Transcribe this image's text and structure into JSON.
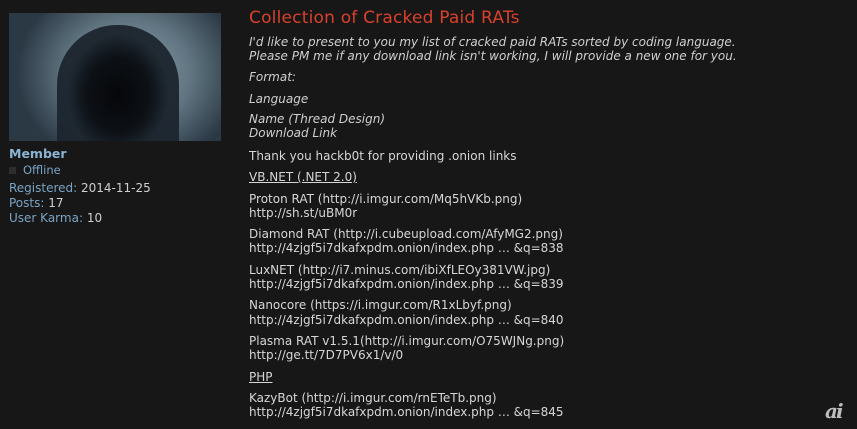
{
  "user": {
    "rank": "Member",
    "status": "Offline",
    "registered_label": "Registered:",
    "registered_value": "2014-11-25",
    "posts_label": "Posts:",
    "posts_value": "17",
    "karma_label": "User Karma:",
    "karma_value": "10"
  },
  "post": {
    "title": "Collection of Cracked Paid RATs",
    "intro_1": "I'd like to present to you my list of cracked paid RATs sorted by coding language.",
    "intro_2": "Please PM me if any download link isn't working, I will provide a new one for you.",
    "format": "Format:",
    "language": "Language",
    "name_design": "Name (Thread Design)",
    "download_link": "Download Link",
    "thanks": "Thank you hackb0t for providing .onion links",
    "section_vb": "VB.NET (.NET 2.0)",
    "proton_1": "Proton RAT (http://i.imgur.com/Mq5hVKb.png)",
    "proton_2": "http://sh.st/uBM0r",
    "diamond_1": "Diamond RAT (http://i.cubeupload.com/AfyMG2.png)",
    "diamond_2": "http://4zjgf5i7dkafxpdm.onion/index.php … &q=838",
    "luxnet_1": "LuxNET (http://i7.minus.com/ibiXfLEOy381VW.jpg)",
    "luxnet_2": "http://4zjgf5i7dkafxpdm.onion/index.php … &q=839",
    "nanocore_1": "Nanocore (https://i.imgur.com/R1xLbyf.png)",
    "nanocore_2": "http://4zjgf5i7dkafxpdm.onion/index.php … &q=840",
    "plasma_1": "Plasma RAT v1.5.1(http://i.imgur.com/O75WJNg.png)",
    "plasma_2": "http://ge.tt/7D7PV6x1/v/0",
    "section_php": "PHP",
    "kazy_1": "KazyBot (http://i.imgur.com/rnETeTb.png)",
    "kazy_2": "http://4zjgf5i7dkafxpdm.onion/index.php … &q=845"
  },
  "watermark": "ai"
}
